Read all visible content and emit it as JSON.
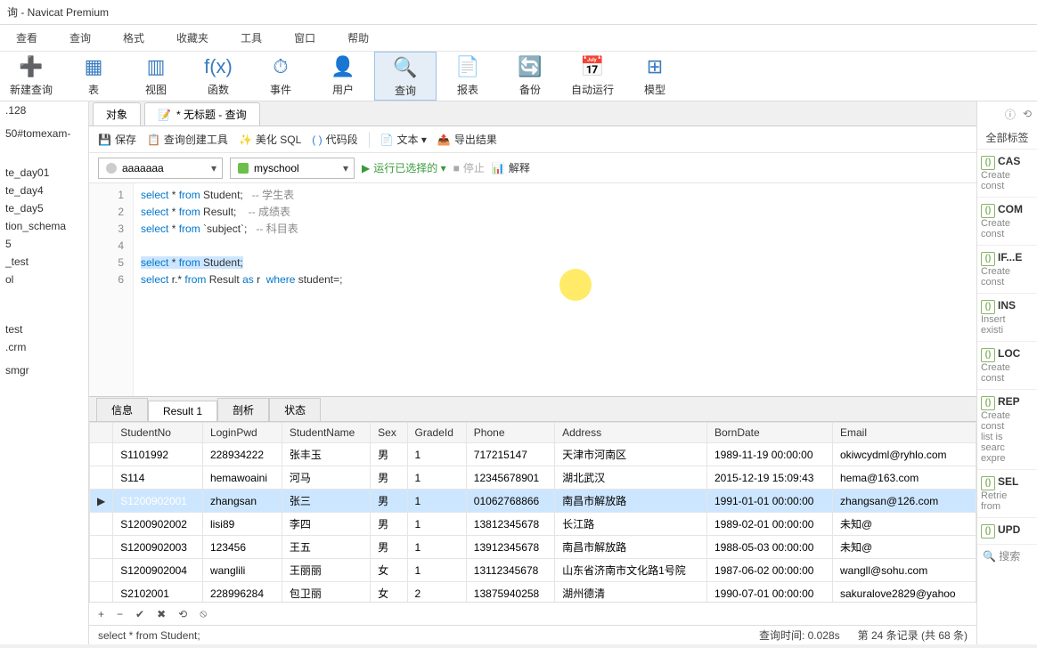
{
  "title": "询 - Navicat Premium",
  "menu": [
    "查看",
    "查询",
    "格式",
    "收藏夹",
    "工具",
    "窗口",
    "帮助"
  ],
  "ribbon": [
    {
      "icon": "➕",
      "label": "新建查询"
    },
    {
      "icon": "▦",
      "label": "表"
    },
    {
      "icon": "▥",
      "label": "视图"
    },
    {
      "icon": "f(x)",
      "label": "函数"
    },
    {
      "icon": "⏱",
      "label": "事件"
    },
    {
      "icon": "👤",
      "label": "用户"
    },
    {
      "icon": "🔍",
      "label": "查询",
      "active": true
    },
    {
      "icon": "📄",
      "label": "报表"
    },
    {
      "icon": "🔄",
      "label": "备份"
    },
    {
      "icon": "📅",
      "label": "自动运行"
    },
    {
      "icon": "⊞",
      "label": "模型"
    }
  ],
  "leftTree": [
    ".128",
    "",
    "50#tomexam-",
    "",
    "",
    "",
    "",
    "te_day01",
    "te_day4",
    "te_day5",
    "tion_schema",
    "5",
    "_test",
    "ol",
    "",
    "",
    "",
    "",
    "",
    "",
    "test",
    ".crm",
    "",
    "smgr"
  ],
  "tabs": {
    "t1": "对象",
    "t2": "* 无标题 - 查询"
  },
  "toolbar1": {
    "save": "保存",
    "builder": "查询创建工具",
    "beautify": "美化 SQL",
    "snippet": "代码段",
    "text": "文本 ▾",
    "export": "导出结果"
  },
  "toolbar2": {
    "conn": "aaaaaaa",
    "db": "myschool",
    "run": "运行已选择的 ▾",
    "stop": "停止",
    "explain": "解释"
  },
  "code": {
    "l1a": "select",
    "l1b": " * ",
    "l1c": "from",
    "l1d": " Student;   ",
    "l1e": "-- 学生表",
    "l2a": "select",
    "l2b": " * ",
    "l2c": "from",
    "l2d": " Result;    ",
    "l2e": "-- 成绩表",
    "l3a": "select",
    "l3b": " * ",
    "l3c": "from",
    "l3d": " `subject`;   ",
    "l3e": "-- 科目表",
    "l5a": "select",
    "l5b": " * ",
    "l5c": "from",
    "l5d": " Student;",
    "l6a": "select",
    "l6b": " r.* ",
    "l6c": "from",
    "l6d": " Result ",
    "l6e": "as",
    "l6f": " r  ",
    "l6g": "where",
    "l6h": " student=;"
  },
  "resultTabs": {
    "info": "信息",
    "r1": "Result 1",
    "profile": "剖析",
    "status": "状态"
  },
  "cols": [
    "StudentNo",
    "LoginPwd",
    "StudentName",
    "Sex",
    "GradeId",
    "Phone",
    "Address",
    "BornDate",
    "Email"
  ],
  "rows": [
    [
      "S1101992",
      "228934222",
      "张丰玉",
      "男",
      "1",
      "717215147",
      "天津市河南区",
      "1989-11-19 00:00:00",
      "okiwcydml@ryhlo.com"
    ],
    [
      "S114",
      "hemawoaini",
      "河马",
      "男",
      "1",
      "12345678901",
      "湖北武汉",
      "2015-12-19 15:09:43",
      "hema@163.com"
    ],
    [
      "S1200902001",
      "zhangsan",
      "张三",
      "男",
      "1",
      "01062768866",
      "南昌市解放路",
      "1991-01-01 00:00:00",
      "zhangsan@126.com"
    ],
    [
      "S1200902002",
      "lisi89",
      "李四",
      "男",
      "1",
      "13812345678",
      "长江路",
      "1989-02-01 00:00:00",
      "未知@"
    ],
    [
      "S1200902003",
      "123456",
      "王五",
      "男",
      "1",
      "13912345678",
      "南昌市解放路",
      "1988-05-03 00:00:00",
      "未知@"
    ],
    [
      "S1200902004",
      "wanglili",
      "王丽丽",
      "女",
      "1",
      "13112345678",
      "山东省济南市文化路1号院",
      "1987-06-02 00:00:00",
      "wangll@sohu.com"
    ],
    [
      "S2102001",
      "228996284",
      "包卫丽",
      "女",
      "2",
      "13875940258",
      "湖州德清",
      "1990-07-01 00:00:00",
      "sakuralove2829@yahoo"
    ]
  ],
  "gridFooter": {
    "add": "+",
    "del": "−",
    "ok": "✔",
    "cancel": "✖",
    "refresh": "⟲",
    "stop": "⦸"
  },
  "status": {
    "left": "select * from Student;",
    "time": "查询时间: 0.028s",
    "rec": "第 24 条记录 (共 68 条)"
  },
  "rightPanel": {
    "allTags": "全部标签",
    "search": "搜索",
    "snips": [
      {
        "t": "CAS",
        "d": "Create\nconst"
      },
      {
        "t": "COM",
        "d": "Create\nconst"
      },
      {
        "t": "IF...E",
        "d": "Create\nconst"
      },
      {
        "t": "INS",
        "d": "Insert\nexisti"
      },
      {
        "t": "LOC",
        "d": "Create\nconst"
      },
      {
        "t": "REP",
        "d": "Create\nconst\nlist is\nsearc\nexpre"
      },
      {
        "t": "SEL",
        "d": "Retrie\nfrom"
      },
      {
        "t": "UPD",
        "d": ""
      }
    ]
  }
}
